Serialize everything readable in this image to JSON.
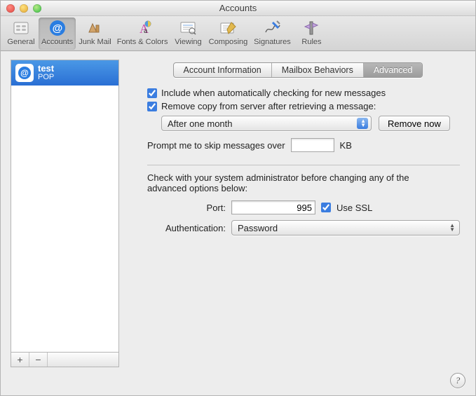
{
  "window": {
    "title": "Accounts"
  },
  "toolbar": {
    "items": [
      {
        "label": "General"
      },
      {
        "label": "Accounts"
      },
      {
        "label": "Junk Mail"
      },
      {
        "label": "Fonts & Colors"
      },
      {
        "label": "Viewing"
      },
      {
        "label": "Composing"
      },
      {
        "label": "Signatures"
      },
      {
        "label": "Rules"
      }
    ],
    "selected_index": 1
  },
  "sidebar": {
    "account": {
      "name": "test",
      "subname": "POP"
    },
    "add_glyph": "+",
    "remove_glyph": "−"
  },
  "tabs": {
    "items": [
      "Account Information",
      "Mailbox Behaviors",
      "Advanced"
    ],
    "selected_index": 2
  },
  "advanced": {
    "include_checking": {
      "checked": true,
      "label": "Include when automatically checking for new messages"
    },
    "remove_copy": {
      "checked": true,
      "label": "Remove copy from server after retrieving a message:"
    },
    "remove_copy_option": "After one month",
    "remove_now_label": "Remove now",
    "skip_label": "Prompt me to skip messages over",
    "skip_value": "",
    "skip_units": "KB",
    "admin_note": "Check with your system administrator before changing any of the advanced options below:",
    "port_label": "Port:",
    "port_value": "995",
    "use_ssl": {
      "checked": true,
      "label": "Use SSL"
    },
    "auth_label": "Authentication:",
    "auth_value": "Password"
  },
  "help_glyph": "?"
}
